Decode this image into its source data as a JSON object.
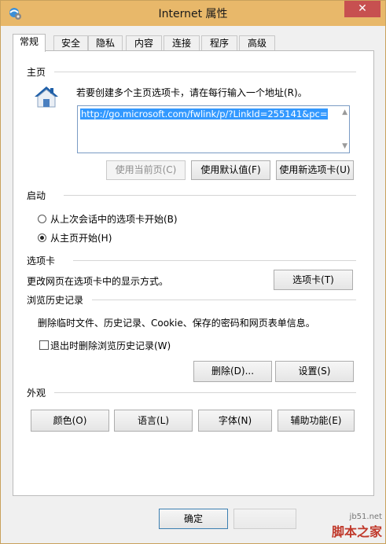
{
  "window": {
    "title": "Internet 属性",
    "close_glyph": "✕"
  },
  "tabs": [
    "常规",
    "安全",
    "隐私",
    "内容",
    "连接",
    "程序",
    "高级"
  ],
  "homepage": {
    "section_title": "主页",
    "instruction": "若要创建多个主页选项卡，请在每行输入一个地址(R)。",
    "url_value": "http://go.microsoft.com/fwlink/p/?LinkId=255141&pc=",
    "btn_use_current": "使用当前页(C)",
    "btn_use_default": "使用默认值(F)",
    "btn_use_new_tab": "使用新选项卡(U)"
  },
  "startup": {
    "section_title": "启动",
    "option_last_session": "从上次会话中的选项卡开始(B)",
    "option_homepage": "从主页开始(H)",
    "selected": "option_homepage"
  },
  "tabs_section": {
    "section_title": "选项卡",
    "description": "更改网页在选项卡中的显示方式。",
    "btn_tabs": "选项卡(T)"
  },
  "history": {
    "section_title": "浏览历史记录",
    "description": "删除临时文件、历史记录、Cookie、保存的密码和网页表单信息。",
    "checkbox_delete_on_exit": "退出时删除浏览历史记录(W)",
    "checkbox_checked": false,
    "btn_delete": "删除(D)...",
    "btn_settings": "设置(S)"
  },
  "appearance": {
    "section_title": "外观",
    "btn_colors": "颜色(O)",
    "btn_languages": "语言(L)",
    "btn_fonts": "字体(N)",
    "btn_accessibility": "辅助功能(E)"
  },
  "footer": {
    "ok": "确定"
  },
  "watermark": {
    "site": "jb51.net",
    "name": "脚本之家"
  },
  "colors": {
    "title_bar": "#e8b86a",
    "close_button": "#c75050",
    "selection": "#3399ff"
  },
  "icons": {
    "title": "ie-settings-icon",
    "home": "home-house-icon"
  }
}
